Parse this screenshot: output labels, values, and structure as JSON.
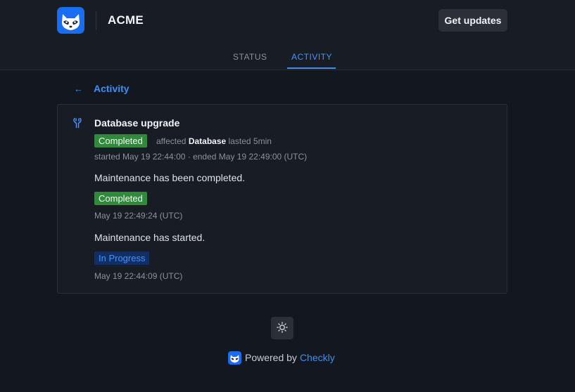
{
  "header": {
    "brand": "ACME",
    "get_updates_label": "Get updates",
    "brand_color": "#1a6cf0"
  },
  "tabs": [
    {
      "label": "STATUS",
      "active": false
    },
    {
      "label": "ACTIVITY",
      "active": true
    }
  ],
  "back": {
    "icon": "arrow-left-icon",
    "label": "Activity"
  },
  "incident": {
    "icon": "wrench-icon",
    "title": "Database upgrade",
    "status": "Completed",
    "affected_prefix": "affected",
    "affected_component": "Database",
    "duration": "lasted 5min",
    "times": "started May 19 22:44:00 · ended May 19 22:49:00 (UTC)",
    "updates": [
      {
        "text": "Maintenance has been completed.",
        "status": "Completed",
        "timestamp": "May 19 22:49:24 (UTC)"
      },
      {
        "text": "Maintenance has started.",
        "status": "In Progress",
        "timestamp": "May 19 22:44:09 (UTC)"
      }
    ]
  },
  "footer": {
    "theme_icon": "sun-icon",
    "powered_by": "Powered by",
    "provider": "Checkly"
  },
  "colors": {
    "accent": "#3e8ef7",
    "completed": "#2f8a3b",
    "in_progress_bg": "#0f2f66"
  }
}
